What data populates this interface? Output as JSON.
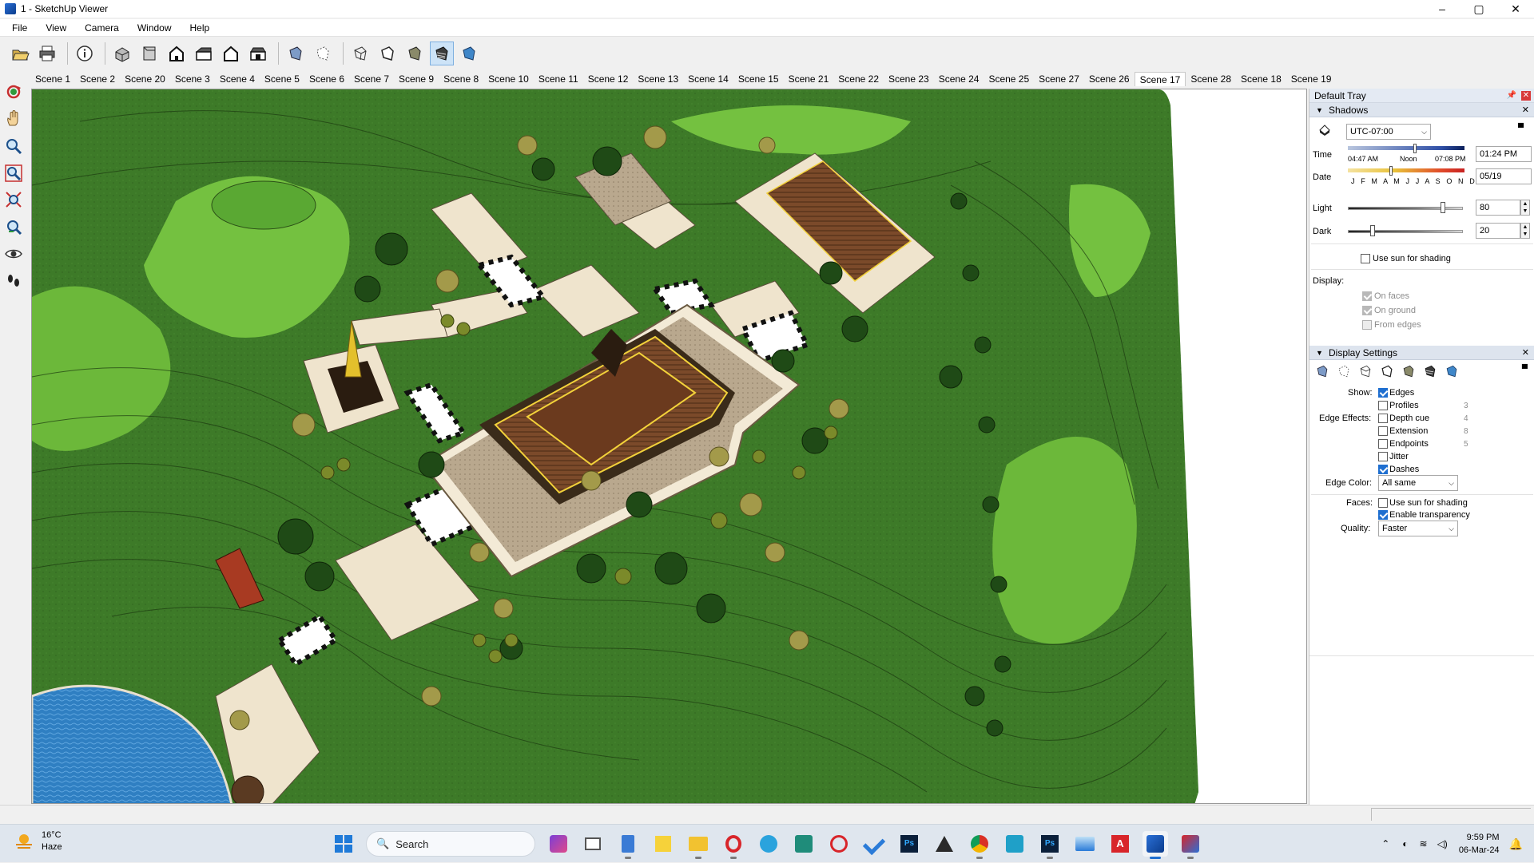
{
  "window": {
    "title": "1 - SketchUp Viewer",
    "controls": [
      "–",
      "▢",
      "✕"
    ]
  },
  "menu": [
    "File",
    "View",
    "Camera",
    "Window",
    "Help"
  ],
  "toolbar": {
    "icons": [
      "open-file-icon",
      "print-icon",
      "model-info-icon",
      "iso-view-icon",
      "top-view-icon",
      "front-view-icon",
      "right-view-icon",
      "back-view-icon",
      "left-view-icon",
      "xray-style-icon",
      "back-edges-style-icon",
      "wireframe-style-icon",
      "hidden-line-style-icon",
      "shaded-style-icon",
      "shaded-with-textures-style-icon",
      "monochrome-style-icon"
    ],
    "active_icon": "shaded-with-textures-style-icon"
  },
  "scenes": {
    "tabs": [
      "Scene 1",
      "Scene 2",
      "Scene 20",
      "Scene 3",
      "Scene 4",
      "Scene 5",
      "Scene 6",
      "Scene 7",
      "Scene 9",
      "Scene 8",
      "Scene 10",
      "Scene 11",
      "Scene 12",
      "Scene 13",
      "Scene 14",
      "Scene 15",
      "Scene 21",
      "Scene 22",
      "Scene 23",
      "Scene 24",
      "Scene 25",
      "Scene 27",
      "Scene 26",
      "Scene 17",
      "Scene 28",
      "Scene 18",
      "Scene 19"
    ],
    "active": "Scene 17"
  },
  "left_tools": [
    "orbit-icon",
    "pan-icon",
    "zoom-icon",
    "zoom-window-icon",
    "zoom-extents-icon",
    "previous-view-icon",
    "look-around-icon",
    "walk-icon"
  ],
  "tray": {
    "title": "Default Tray",
    "shadows": {
      "title": "Shadows",
      "timezone": "UTC-07:00",
      "time_label": "Time",
      "sunrise": "04:47 AM",
      "noon": "Noon",
      "sunset": "07:08 PM",
      "time_value": "01:24 PM",
      "date_label": "Date",
      "months": "J F M A M J J A S O N D",
      "date_value": "05/19",
      "light_label": "Light",
      "light_value": "80",
      "dark_label": "Dark",
      "dark_value": "20",
      "use_sun_label": "Use sun for shading",
      "display_label": "Display:",
      "on_faces": "On faces",
      "on_ground": "On ground",
      "from_edges": "From edges"
    },
    "display_settings": {
      "title": "Display Settings",
      "show_label": "Show:",
      "edges": "Edges",
      "edge_effects_label": "Edge Effects:",
      "profiles": "Profiles",
      "profiles_num": "3",
      "depth_cue": "Depth cue",
      "depth_cue_num": "4",
      "extension": "Extension",
      "extension_num": "8",
      "endpoints": "Endpoints",
      "endpoints_num": "5",
      "jitter": "Jitter",
      "dashes": "Dashes",
      "edge_color_label": "Edge Color:",
      "edge_color_value": "All same",
      "faces_label": "Faces:",
      "use_sun_shading": "Use sun for shading",
      "enable_transparency": "Enable transparency",
      "quality_label": "Quality:",
      "quality_value": "Faster"
    }
  },
  "taskbar": {
    "weather_temp": "16°C",
    "weather_desc": "Haze",
    "search_placeholder": "Search",
    "time": "9:59 PM",
    "date": "06-Mar-24"
  }
}
